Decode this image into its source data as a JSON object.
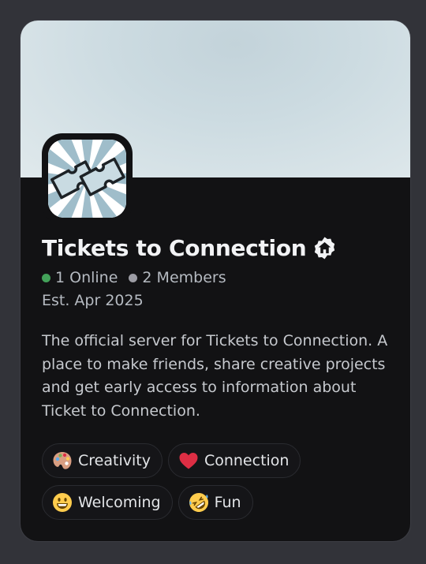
{
  "server": {
    "name": "Tickets to Connection",
    "badge_icon": "community-home-badge-icon",
    "online": "1 Online",
    "members": "2 Members",
    "established": "Est. Apr 2025",
    "description": "The official server for Tickets to Connection. A place to make friends, share creative projects and get early access to information about Ticket to Connection."
  },
  "tags": [
    {
      "emoji": "artist-palette-icon",
      "label": "Creativity"
    },
    {
      "emoji": "red-heart-icon",
      "label": "Connection"
    },
    {
      "emoji": "grinning-face-icon",
      "label": "Welcoming"
    },
    {
      "emoji": "rofl-face-icon",
      "label": "Fun"
    }
  ],
  "colors": {
    "card_bg": "#121214",
    "online_dot": "#43a25a",
    "members_dot": "#9c9ca4",
    "banner": "#ccdbe1"
  }
}
